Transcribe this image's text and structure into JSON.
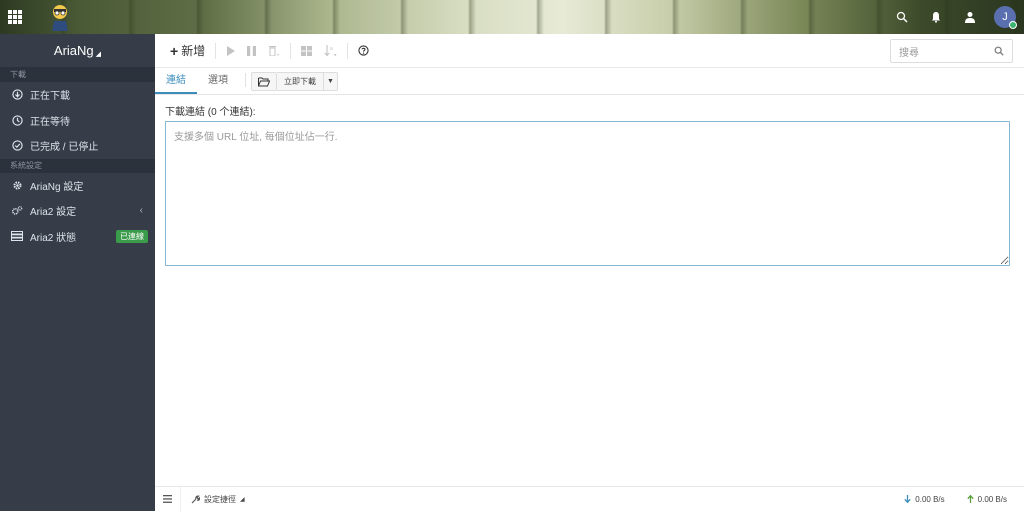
{
  "brand": {
    "title": "AriaNg"
  },
  "sidebar": {
    "section_download": "下載",
    "section_settings": "系統設定",
    "items": [
      {
        "label": "正在下載",
        "icon": "arrow-circle-down-icon"
      },
      {
        "label": "正在等待",
        "icon": "clock-icon"
      },
      {
        "label": "已完成 / 已停止",
        "icon": "check-circle-icon"
      },
      {
        "label": "AriaNg 設定",
        "icon": "gear-icon"
      },
      {
        "label": "Aria2 設定",
        "icon": "gears-icon"
      },
      {
        "label": "Aria2 狀態",
        "icon": "server-icon",
        "badge": "已連線"
      }
    ]
  },
  "toolbar": {
    "new_label": "新增"
  },
  "search": {
    "placeholder": "搜尋"
  },
  "tabs": {
    "links": "連結",
    "options": "選項"
  },
  "download_now": "立即下載",
  "form": {
    "label": "下載連結 (0 个連結):",
    "placeholder": "支援多個 URL 位址, 每個位址佔一行."
  },
  "footer": {
    "shortcut_label": "設定捷徑",
    "download_speed": "0.00 B/s",
    "upload_speed": "0.00 B/s"
  },
  "user": {
    "initial": "J"
  },
  "colors": {
    "accent": "#3c8dbc",
    "sidebar_bg": "#363d48",
    "badge_green": "#3a9b4a",
    "download_arrow": "#3c8dbc",
    "upload_arrow": "#5aa03c"
  }
}
